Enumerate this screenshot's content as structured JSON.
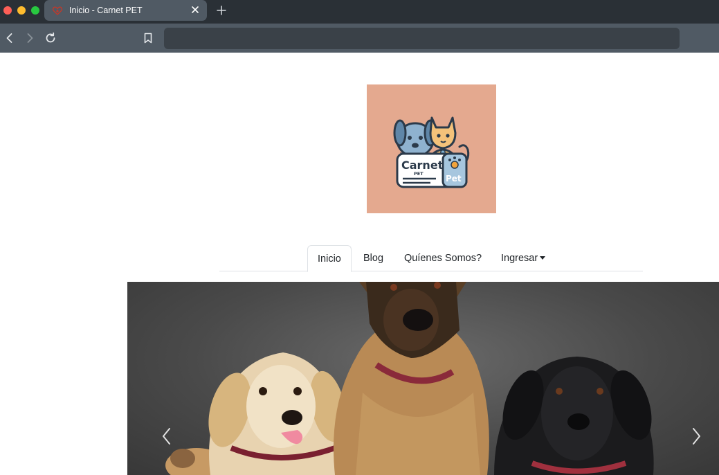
{
  "browser": {
    "tab": {
      "title": "Inicio - Carnet PET"
    }
  },
  "logo": {
    "text_main": "Carnet",
    "text_sub": "PET",
    "text_badge": "Pet",
    "background_color": "#e4a98f"
  },
  "nav": {
    "items": [
      {
        "label": "Inicio",
        "active": true
      },
      {
        "label": "Blog",
        "active": false
      },
      {
        "label": "Quíenes Somos?",
        "active": false
      },
      {
        "label": "Ingresar",
        "active": false,
        "dropdown": true
      }
    ]
  },
  "carousel": {
    "prev_icon": "chevron-left-icon",
    "next_icon": "chevron-right-icon"
  }
}
